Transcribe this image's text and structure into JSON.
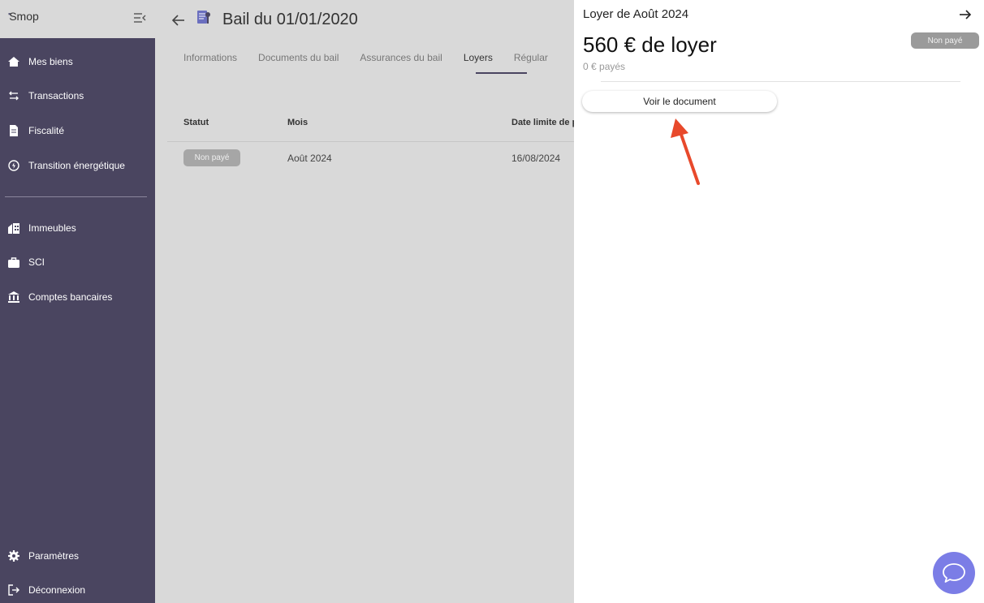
{
  "sidebar": {
    "logo": "Smop",
    "logo_mark": "▪",
    "items": [
      {
        "label": "Mes biens",
        "icon": "house-icon"
      },
      {
        "label": "Transactions",
        "icon": "swap-icon"
      },
      {
        "label": "Fiscalité",
        "icon": "document-icon"
      },
      {
        "label": "Transition énergétique",
        "icon": "energy-icon"
      },
      {
        "label": "Immeubles",
        "icon": "building-icon"
      },
      {
        "label": "SCI",
        "icon": "briefcase-icon"
      },
      {
        "label": "Comptes bancaires",
        "icon": "bank-icon"
      },
      {
        "label": "Paramètres",
        "icon": "gear-icon"
      },
      {
        "label": "Déconnexion",
        "icon": "logout-icon"
      }
    ]
  },
  "header": {
    "title": "Bail du 01/01/2020",
    "tabs": [
      {
        "label": "Informations"
      },
      {
        "label": "Documents du bail"
      },
      {
        "label": "Assurances du bail"
      },
      {
        "label": "Loyers",
        "active": true
      },
      {
        "label": "Régular"
      }
    ]
  },
  "table": {
    "columns": [
      "Statut",
      "Mois",
      "Date limite de p"
    ],
    "rows": [
      {
        "statut": "Non payé",
        "mois": "Août 2024",
        "date": "16/08/2024"
      }
    ]
  },
  "panel": {
    "title": "Loyer de Août 2024",
    "amount": "560 € de loyer",
    "paid": "0 € payés",
    "badge": "Non payé",
    "button": "Voir le document"
  },
  "colors": {
    "sidebar_bg": "#4a4560",
    "accent": "#7b7de6",
    "annotation_arrow": "#e8492b"
  }
}
